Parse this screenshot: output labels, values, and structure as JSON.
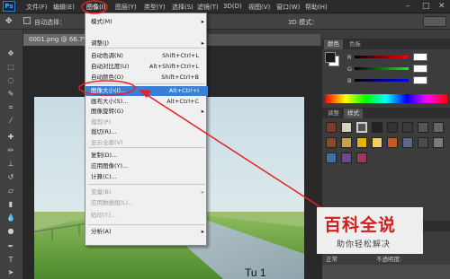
{
  "app": {
    "logo": "Ps"
  },
  "menubar": {
    "items": [
      "文件(F)",
      "编辑(E)",
      "图像(I)",
      "图层(Y)",
      "类型(Y)",
      "选择(S)",
      "滤镜(T)",
      "3D(D)",
      "视图(V)",
      "窗口(W)",
      "帮助(H)"
    ],
    "window_controls": [
      "–",
      "□",
      "✕"
    ]
  },
  "options": {
    "auto_select": "自动选择：",
    "zoom_partial": "@ 66.7",
    "mode_3d": "3D 模式："
  },
  "document": {
    "tab_title": "0001.png @ 66.7%",
    "photo_text": "Tu 1"
  },
  "panels": {
    "color_tabs": [
      "颜色",
      "色板"
    ],
    "color_labels": [
      "R",
      "G",
      "B"
    ],
    "adjust_tabs": [
      "调整",
      "样式"
    ],
    "layers_field": "不透明度:",
    "normal_label": "正常"
  },
  "image_menu": {
    "items": [
      {
        "label": "模式(M)",
        "shortcut": "",
        "submenu": true,
        "disabled": false
      },
      {
        "label": "调整(J)",
        "shortcut": "",
        "submenu": true,
        "disabled": false
      },
      {
        "label": "自动色调(N)",
        "shortcut": "Shift+Ctrl+L",
        "submenu": false,
        "disabled": false
      },
      {
        "label": "自动对比度(U)",
        "shortcut": "Alt+Shift+Ctrl+L",
        "submenu": false,
        "disabled": false
      },
      {
        "label": "自动颜色(O)",
        "shortcut": "Shift+Ctrl+B",
        "submenu": false,
        "disabled": false
      },
      {
        "label": "图像大小(I)...",
        "shortcut": "Alt+Ctrl+I",
        "submenu": false,
        "disabled": false,
        "highlighted": true
      },
      {
        "label": "画布大小(S)...",
        "shortcut": "Alt+Ctrl+C",
        "submenu": false,
        "disabled": false
      },
      {
        "label": "图像旋转(G)",
        "shortcut": "",
        "submenu": true,
        "disabled": false
      },
      {
        "label": "裁剪(P)",
        "shortcut": "",
        "submenu": false,
        "disabled": true
      },
      {
        "label": "裁切(R)...",
        "shortcut": "",
        "submenu": false,
        "disabled": false
      },
      {
        "label": "显示全部(V)",
        "shortcut": "",
        "submenu": false,
        "disabled": true
      },
      {
        "label": "复制(D)...",
        "shortcut": "",
        "submenu": false,
        "disabled": false
      },
      {
        "label": "应用图像(Y)...",
        "shortcut": "",
        "submenu": false,
        "disabled": false
      },
      {
        "label": "计算(C)...",
        "shortcut": "",
        "submenu": false,
        "disabled": false
      },
      {
        "label": "变量(B)",
        "shortcut": "",
        "submenu": true,
        "disabled": true
      },
      {
        "label": "应用数据组(L)...",
        "shortcut": "",
        "submenu": false,
        "disabled": true
      },
      {
        "label": "陷印(T)...",
        "shortcut": "",
        "submenu": false,
        "disabled": true
      },
      {
        "label": "分析(A)",
        "shortcut": "",
        "submenu": true,
        "disabled": false
      }
    ]
  },
  "watermark": {
    "title": "百科全说",
    "subtitle": "助你轻松解决"
  },
  "colors": {
    "annotation": "#e8201e",
    "highlight": "#3a7fd4",
    "menu_bg": "#f0f0f0"
  }
}
